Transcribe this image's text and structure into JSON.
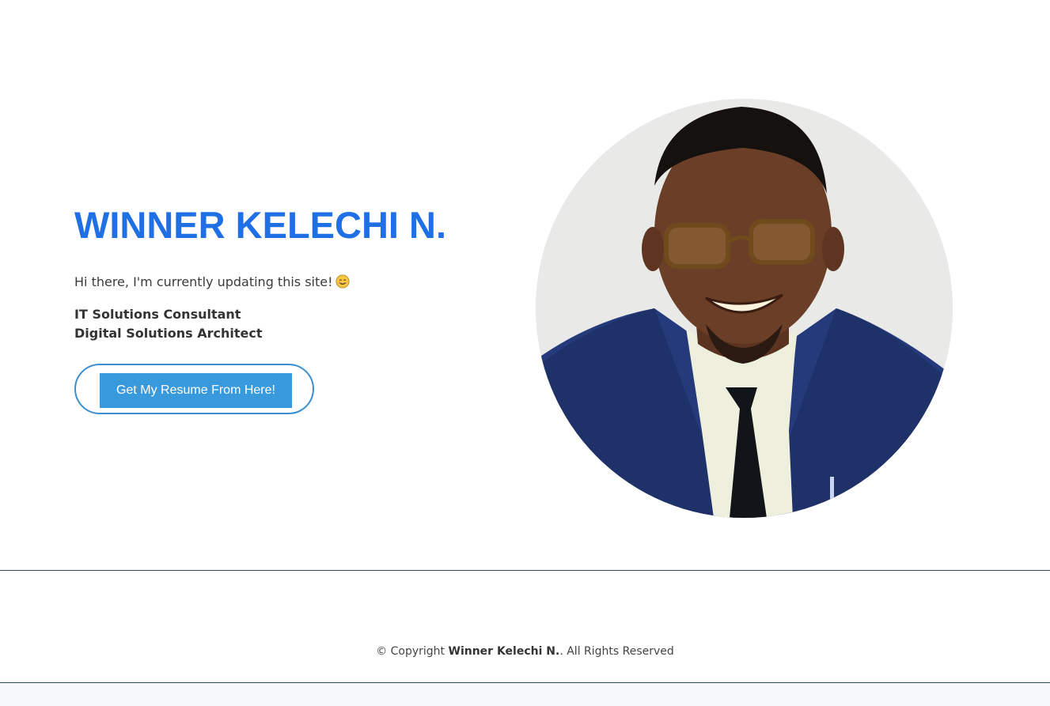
{
  "hero": {
    "title": "WINNER KELECHI N.",
    "intro": "Hi there, I'm currently updating this site!",
    "intro_emoji": "smiling-face-emoji",
    "roles": [
      "IT Solutions Consultant",
      "Digital Solutions Architect"
    ],
    "resume_button_label": "Get My Resume From Here!"
  },
  "portrait": {
    "icon": "profile-photo"
  },
  "footer": {
    "copyright_prefix": "© Copyright",
    "copyright_name": "Winner Kelechi N.",
    "copyright_suffix": ". All Rights Reserved"
  },
  "colors": {
    "title": "#1f6fe5",
    "button": "#3899dc",
    "button_outline": "#3a8fd1",
    "divider": "#2e4a57",
    "portrait_bg": "#e9e9e8"
  }
}
